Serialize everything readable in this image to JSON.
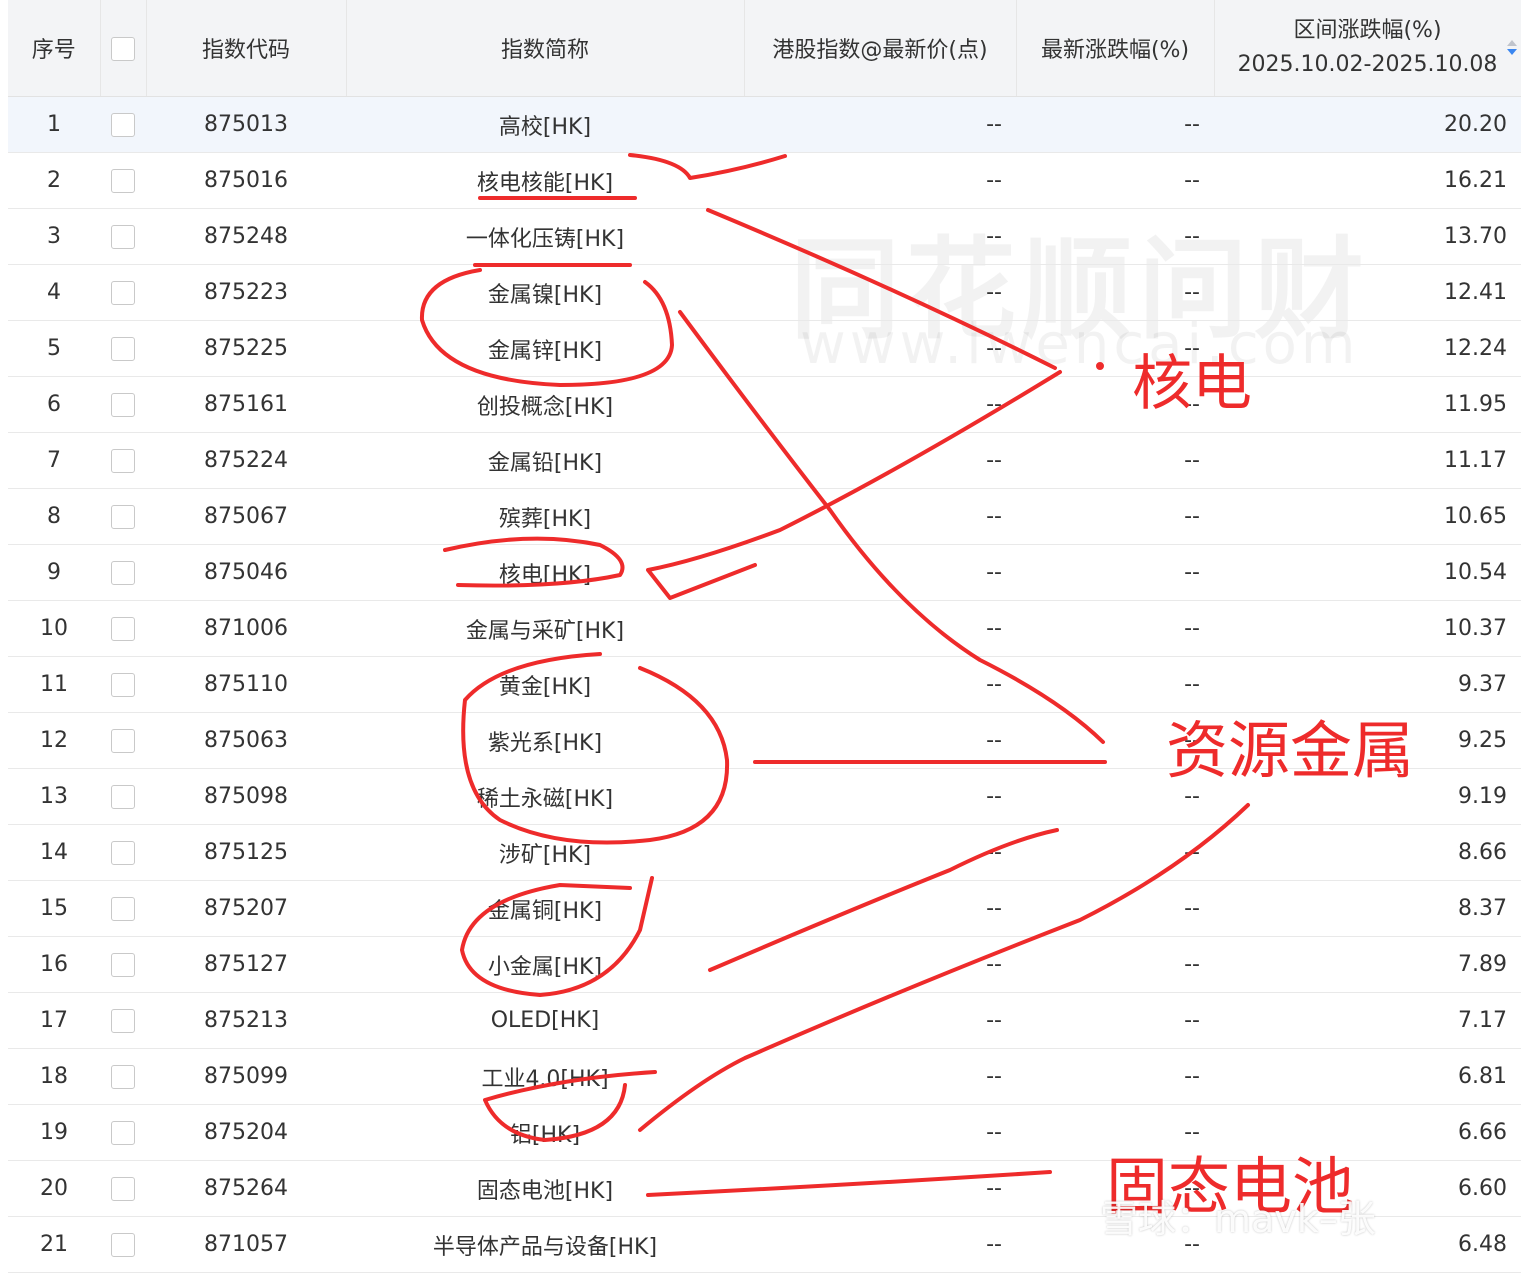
{
  "table": {
    "headers": {
      "index": "序号",
      "code": "指数代码",
      "name": "指数简称",
      "price": "港股指数@最新价(点)",
      "change": "最新涨跌幅(%)",
      "range_title": "区间涨跌幅(%)",
      "range_dates": "2025.10.02-2025.10.08"
    },
    "rows": [
      {
        "idx": "1",
        "code": "875013",
        "name": "高校[HK]",
        "price": "--",
        "change": "--",
        "range": "20.20"
      },
      {
        "idx": "2",
        "code": "875016",
        "name": "核电核能[HK]",
        "price": "--",
        "change": "--",
        "range": "16.21"
      },
      {
        "idx": "3",
        "code": "875248",
        "name": "一体化压铸[HK]",
        "price": "--",
        "change": "--",
        "range": "13.70"
      },
      {
        "idx": "4",
        "code": "875223",
        "name": "金属镍[HK]",
        "price": "--",
        "change": "--",
        "range": "12.41"
      },
      {
        "idx": "5",
        "code": "875225",
        "name": "金属锌[HK]",
        "price": "--",
        "change": "--",
        "range": "12.24"
      },
      {
        "idx": "6",
        "code": "875161",
        "name": "创投概念[HK]",
        "price": "--",
        "change": "--",
        "range": "11.95"
      },
      {
        "idx": "7",
        "code": "875224",
        "name": "金属铅[HK]",
        "price": "--",
        "change": "--",
        "range": "11.17"
      },
      {
        "idx": "8",
        "code": "875067",
        "name": "殡葬[HK]",
        "price": "--",
        "change": "--",
        "range": "10.65"
      },
      {
        "idx": "9",
        "code": "875046",
        "name": "核电[HK]",
        "price": "--",
        "change": "--",
        "range": "10.54"
      },
      {
        "idx": "10",
        "code": "871006",
        "name": "金属与采矿[HK]",
        "price": "--",
        "change": "--",
        "range": "10.37"
      },
      {
        "idx": "11",
        "code": "875110",
        "name": "黄金[HK]",
        "price": "--",
        "change": "--",
        "range": "9.37"
      },
      {
        "idx": "12",
        "code": "875063",
        "name": "紫光系[HK]",
        "price": "--",
        "change": "--",
        "range": "9.25"
      },
      {
        "idx": "13",
        "code": "875098",
        "name": "稀土永磁[HK]",
        "price": "--",
        "change": "--",
        "range": "9.19"
      },
      {
        "idx": "14",
        "code": "875125",
        "name": "涉矿[HK]",
        "price": "--",
        "change": "--",
        "range": "8.66"
      },
      {
        "idx": "15",
        "code": "875207",
        "name": "金属铜[HK]",
        "price": "--",
        "change": "--",
        "range": "8.37"
      },
      {
        "idx": "16",
        "code": "875127",
        "name": "小金属[HK]",
        "price": "--",
        "change": "--",
        "range": "7.89"
      },
      {
        "idx": "17",
        "code": "875213",
        "name": "OLED[HK]",
        "price": "--",
        "change": "--",
        "range": "7.17"
      },
      {
        "idx": "18",
        "code": "875099",
        "name": "工业4.0[HK]",
        "price": "--",
        "change": "--",
        "range": "6.81"
      },
      {
        "idx": "19",
        "code": "875204",
        "name": "铝[HK]",
        "price": "--",
        "change": "--",
        "range": "6.66"
      },
      {
        "idx": "20",
        "code": "875264",
        "name": "固态电池[HK]",
        "price": "--",
        "change": "--",
        "range": "6.60"
      },
      {
        "idx": "21",
        "code": "871057",
        "name": "半导体产品与设备[HK]",
        "price": "--",
        "change": "--",
        "range": "6.48"
      }
    ]
  },
  "watermark": {
    "cn": "同花顺问财",
    "url": "www.iwencai.com"
  },
  "annotations": {
    "label1": "核电",
    "label2": "资源金属",
    "label3": "固态电池"
  },
  "footer_watermark": "雪球：mavk–张",
  "colors": {
    "link": "#1a5fd6",
    "annotation": "#ee2b2b",
    "header_bg": "#f3f4f6",
    "highlight_row": "#f2f6fc"
  }
}
